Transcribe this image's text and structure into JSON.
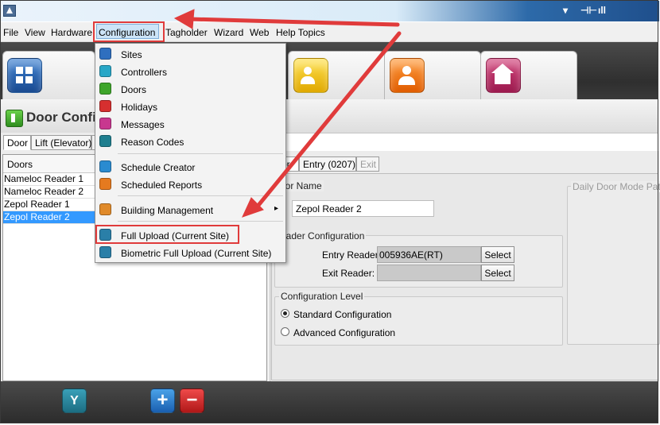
{
  "menubar": {
    "items": [
      "File",
      "View",
      "Hardware",
      "Configuration",
      "Tagholder",
      "Wizard",
      "Web",
      "Help Topics"
    ]
  },
  "tray": {
    "arrow": "▾",
    "signal": "ıll",
    "network": "⊣⊢"
  },
  "header": {
    "title": "Door Config"
  },
  "left_tabs": [
    "Door",
    "Lift (Elevator)"
  ],
  "doors": {
    "header": "Doors",
    "items": [
      "Nameloc Reader 1",
      "Nameloc Reader 2",
      "Zepol Reader 1",
      "Zepol Reader 2"
    ],
    "selected": "Zepol Reader 2"
  },
  "right_tabs": [
    "or",
    "Entry (0207)",
    "Exit"
  ],
  "door_name": {
    "label": "oor Name",
    "value": "Zepol Reader 2"
  },
  "reader_config": {
    "title": "eader Configuration",
    "entry_label": "Entry Reader:",
    "entry_value": "005936AE(RT)",
    "exit_label": "Exit Reader:",
    "exit_value": "",
    "select_label": "Select"
  },
  "config_level": {
    "title": "Configuration Level",
    "standard": "Standard Configuration",
    "advanced": "Advanced Configuration",
    "selected": "standard"
  },
  "daily_mode": {
    "title": "Daily Door Mode Patter"
  },
  "dropdown": {
    "items": [
      {
        "label": "Sites",
        "icon": "sites-icon",
        "color": "#2f6fbf"
      },
      {
        "label": "Controllers",
        "icon": "controllers-icon",
        "color": "#28a7c7"
      },
      {
        "label": "Doors",
        "icon": "doors-icon",
        "color": "#3ea52a"
      },
      {
        "label": "Holidays",
        "icon": "holidays-icon",
        "color": "#d62f2f"
      },
      {
        "label": "Messages",
        "icon": "messages-icon",
        "color": "#c8378f"
      },
      {
        "label": "Reason Codes",
        "icon": "reason-codes-icon",
        "color": "#1f7f8f"
      },
      {
        "label": "Schedule Creator",
        "icon": "schedule-creator-icon",
        "color": "#2a8bd0"
      },
      {
        "label": "Scheduled Reports",
        "icon": "scheduled-reports-icon",
        "color": "#e57a1f"
      },
      {
        "label": "Building Management",
        "icon": "building-management-icon",
        "color": "#e08a2a"
      },
      {
        "label": "Full Upload (Current Site)",
        "icon": "full-upload-icon",
        "color": "#2a7fa8"
      },
      {
        "label": "Biometric Full Upload (Current Site)",
        "icon": "biometric-upload-icon",
        "color": "#2a7fa8"
      }
    ],
    "submenu_arrow": "▸"
  },
  "bottom": {
    "filter": "Y",
    "add": "+",
    "remove": "−"
  },
  "colors": {
    "selected_row": "#3399ff",
    "annotation": "#e03b3b"
  }
}
